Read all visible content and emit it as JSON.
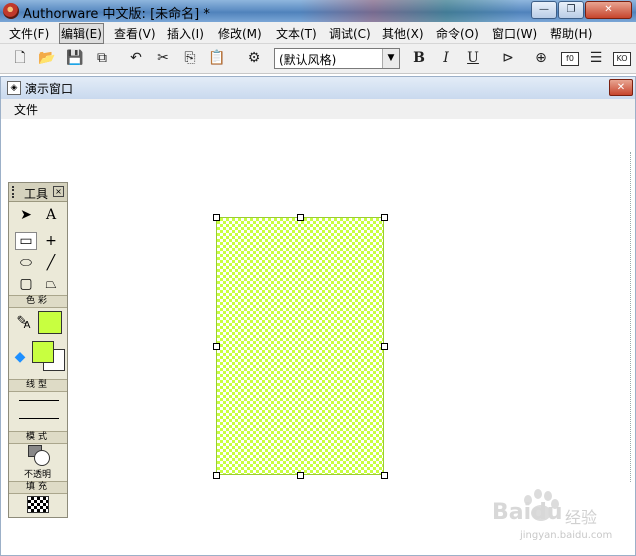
{
  "app": {
    "title": "Authorware 中文版: [未命名] *"
  },
  "menubar": {
    "items": [
      "文件(F)",
      "编辑(E)",
      "查看(V)",
      "插入(I)",
      "修改(M)",
      "文本(T)",
      "调试(C)",
      "其他(X)",
      "命令(O)",
      "窗口(W)",
      "帮助(H)"
    ]
  },
  "toolbar": {
    "style_select_value": "(默认风格)",
    "bold_label": "B",
    "italic_label": "I",
    "underline_label": "U"
  },
  "presentation_window": {
    "title": "演示窗口",
    "menu_file": "文件"
  },
  "tools_palette": {
    "title": "工具",
    "section_color": "色彩",
    "section_line": "线型",
    "section_mode": "模式",
    "mode_value": "不透明",
    "section_fill": "填充"
  },
  "colors": {
    "fill": "#c8ff40",
    "outline": "#9acd32"
  },
  "watermark": {
    "brand": "Baidu",
    "brand_cn": "经验",
    "url": "jingyan.baidu.com"
  }
}
